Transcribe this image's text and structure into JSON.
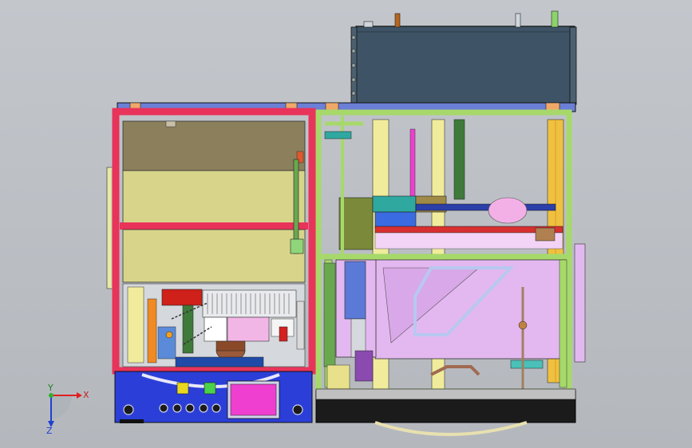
{
  "triad": {
    "x_label": "X",
    "y_label": "Y",
    "z_label": "Z"
  },
  "colors": {
    "background": "#bcc0c5",
    "frame_red": "#e8335a",
    "frame_green": "#a6d96a",
    "panel_blue": "#2b3fd8",
    "top_box": "#3e5466",
    "olive_panel": "#8c7f5c",
    "khaki_panel": "#d8d58a",
    "lavender": "#e3b8f0",
    "magenta_screen": "#ee3fd0",
    "base_black": "#1b1b1b"
  },
  "icons": {
    "triad": "coordinate-axes-icon"
  }
}
